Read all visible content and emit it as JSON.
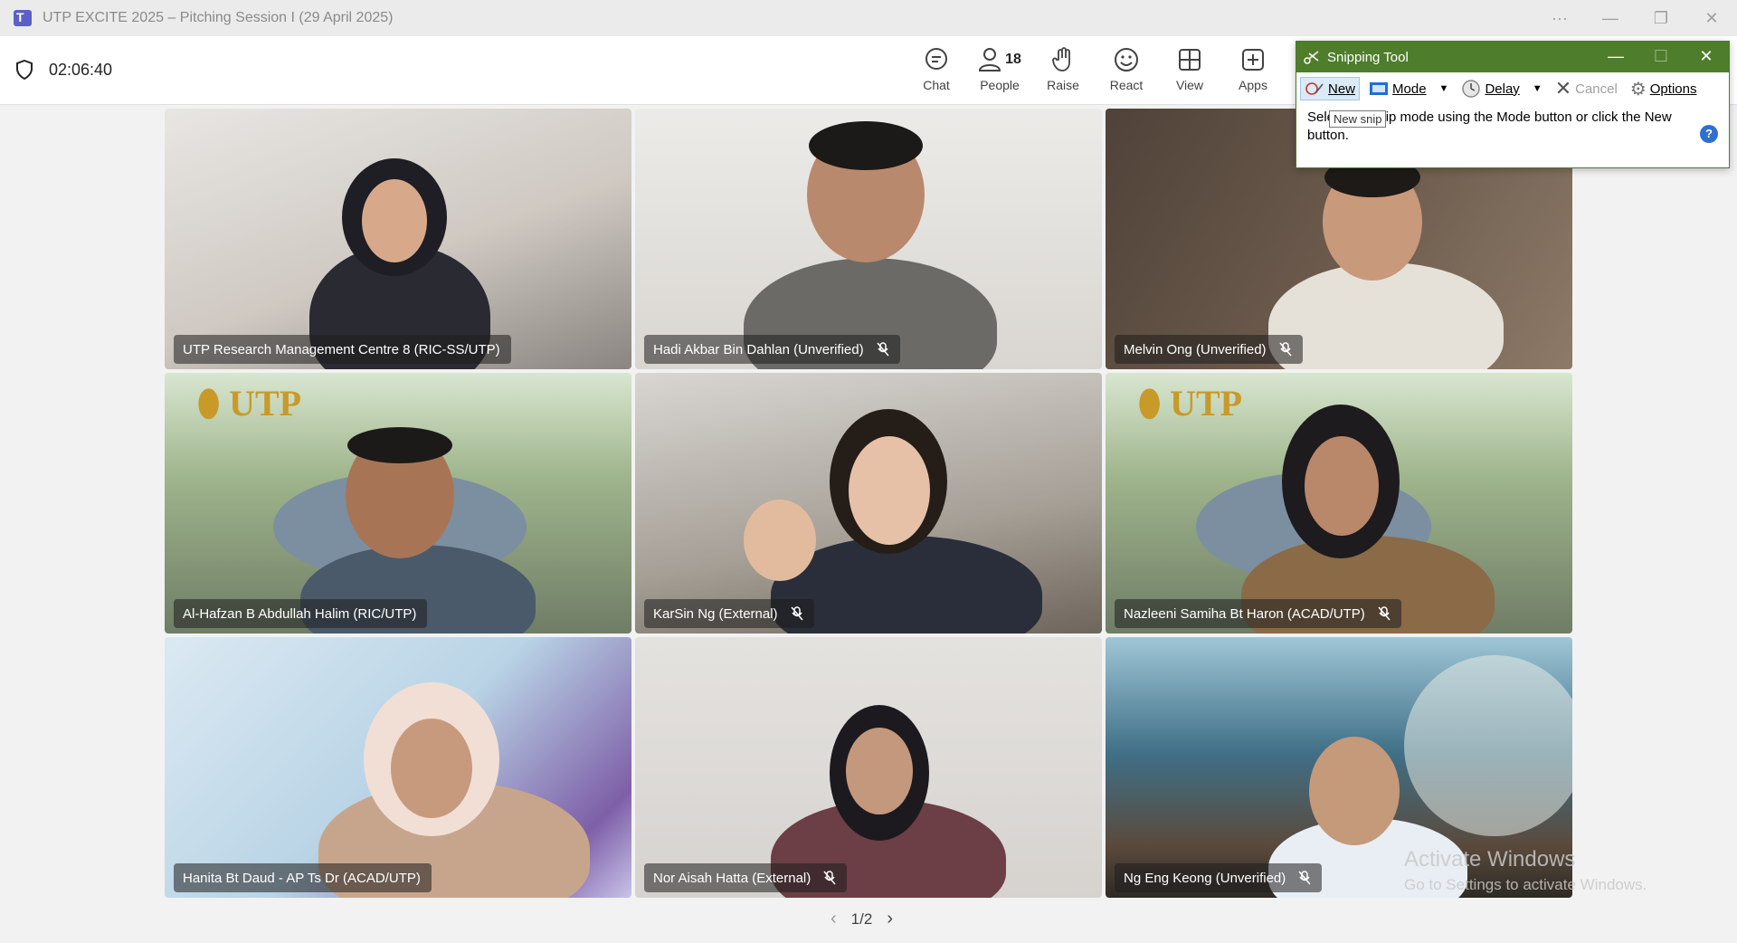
{
  "window": {
    "title": "UTP EXCITE 2025 – Pitching Session I (29 April 2025)",
    "controls": [
      "more-icon",
      "minimize-icon",
      "restore-icon",
      "close-icon"
    ]
  },
  "meeting": {
    "timer": "02:06:40",
    "toolbar": [
      {
        "id": "chat",
        "label": "Chat",
        "icon": "chat-icon"
      },
      {
        "id": "people",
        "label": "People",
        "icon": "people-icon",
        "count": "18"
      },
      {
        "id": "raise",
        "label": "Raise",
        "icon": "raise-hand-icon"
      },
      {
        "id": "react",
        "label": "React",
        "icon": "smiley-icon"
      },
      {
        "id": "view",
        "label": "View",
        "icon": "view-grid-icon"
      },
      {
        "id": "apps",
        "label": "Apps",
        "icon": "apps-plus-icon"
      }
    ]
  },
  "participants": [
    {
      "name": "UTP Research Management Centre 8 (RIC-SS/UTP)",
      "muted": false,
      "bg": "#cfc9c2"
    },
    {
      "name": "Hadi Akbar Bin Dahlan (Unverified)",
      "muted": true,
      "bg": "#d9d6d1"
    },
    {
      "name": "Melvin Ong (Unverified)",
      "muted": true,
      "bg": "#6b5a4c"
    },
    {
      "name": "Al-Hafzan B Abdullah Halim (RIC/UTP)",
      "muted": false,
      "bg": "#8ea07a"
    },
    {
      "name": "KarSin Ng (External)",
      "muted": true,
      "bg": "#b8b2a8"
    },
    {
      "name": "Nazleeni Samiha Bt Haron (ACAD/UTP)",
      "muted": true,
      "bg": "#8ea07a"
    },
    {
      "name": "Hanita Bt Daud - AP Ts Dr (ACAD/UTP)",
      "muted": false,
      "bg": "#b9d4e6"
    },
    {
      "name": "Nor Aisah Hatta (External)",
      "muted": true,
      "bg": "#d6d3cf"
    },
    {
      "name": "Ng Eng Keong (Unverified)",
      "muted": true,
      "bg": "#3f6f86"
    }
  ],
  "pager": {
    "label": "1/2"
  },
  "watermark": {
    "title": "Activate Windows",
    "subtitle": "Go to Settings to activate Windows."
  },
  "snipping_tool": {
    "title": "Snipping Tool",
    "buttons": {
      "new": "New",
      "mode": "Mode",
      "delay": "Delay",
      "cancel": "Cancel",
      "options": "Options"
    },
    "tooltip": "New snip",
    "message": "Select the snip mode using the Mode button or click the New button.",
    "help": "?"
  },
  "colors": {
    "accent": "#5b5fc7",
    "snip_title": "#4e7d2c"
  }
}
